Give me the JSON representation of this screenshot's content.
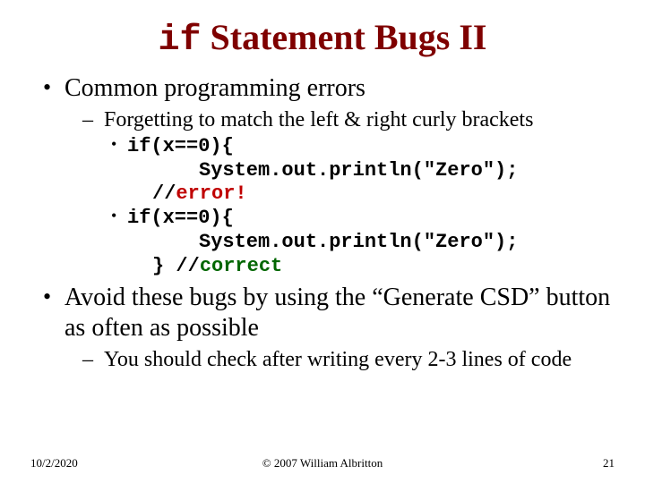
{
  "title": {
    "code": "if",
    "rest": " Statement Bugs II"
  },
  "bullets": {
    "b1": "Common programming errors",
    "b1_sub1": "Forgetting to match the left & right curly brackets",
    "b2": "Avoid these bugs by using the “Generate CSD” button as often as possible",
    "b2_sub1": "You should check after writing every 2-3 lines of code"
  },
  "code": {
    "l1": "if(x==0){",
    "l2": "System.out.println(\"Zero\");",
    "l3a": "//",
    "l3b": "error!",
    "l4": "if(x==0){",
    "l5": "System.out.println(\"Zero\");",
    "l6a": "} //",
    "l6b": "correct"
  },
  "footer": {
    "date": "10/2/2020",
    "copyright": "© 2007 William Albritton",
    "page": "21"
  }
}
